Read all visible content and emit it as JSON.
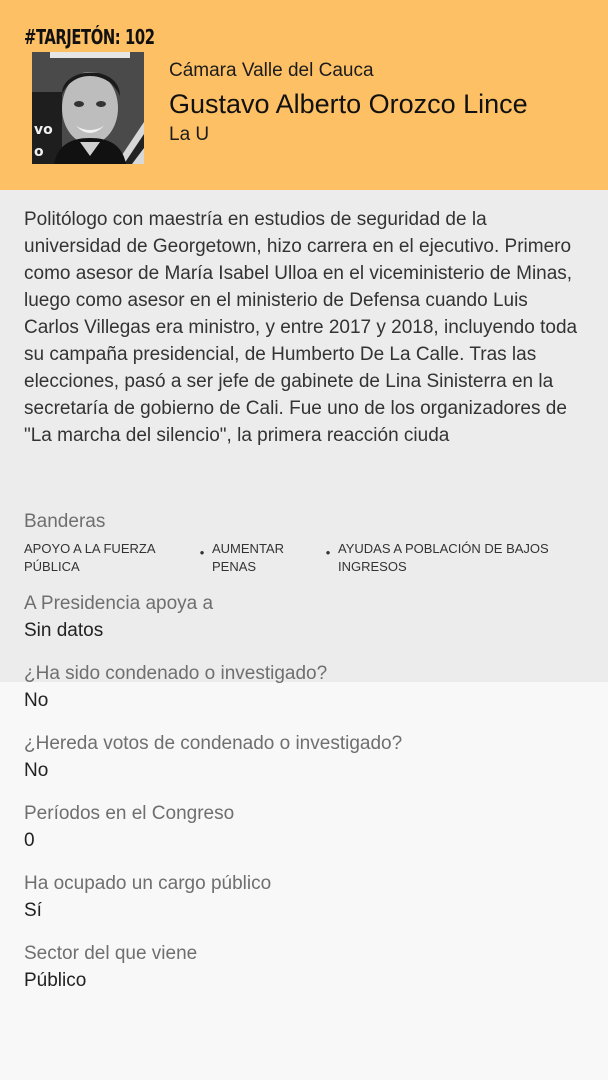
{
  "header": {
    "tag": "#TARJETÓN: 102",
    "chamber": "Cámara Valle del Cauca",
    "name": "Gustavo Alberto Orozco Lince",
    "party": "La U",
    "background_color": "#fec064"
  },
  "bio": {
    "text": "Politólogo con maestría en estudios de seguridad de la universidad de Georgetown, hizo carrera en el ejecutivo. Primero como asesor de María Isabel Ulloa en el viceministerio de Minas, luego como asesor en el ministerio de Defensa cuando Luis Carlos Villegas era ministro, y entre 2017 y 2018, incluyendo toda su campaña presidencial, de Humberto De La Calle. Tras las elecciones, pasó a ser jefe de gabinete de Lina Sinisterra en la secretaría de gobierno de Cali. Fue uno de los organizadores de \"La marcha del silencio\", la primera reacción ciuda"
  },
  "banderas": {
    "label": "Banderas",
    "items": [
      "APOYO A LA FUERZA PÚBLICA",
      "AUMENTAR PENAS",
      "AYUDAS A POBLACIÓN DE BAJOS INGRESOS"
    ],
    "separator": "•"
  },
  "details": [
    {
      "label": "A Presidencia apoya a",
      "value": "Sin datos"
    },
    {
      "label": "¿Ha sido condenado o investigado?",
      "value": "No"
    },
    {
      "label": "¿Hereda votos de condenado o investigado?",
      "value": "No"
    },
    {
      "label": "Períodos en el Congreso",
      "value": "0"
    },
    {
      "label": "Ha ocupado un cargo público",
      "value": "Sí"
    },
    {
      "label": "Sector del que viene",
      "value": "Público"
    }
  ]
}
